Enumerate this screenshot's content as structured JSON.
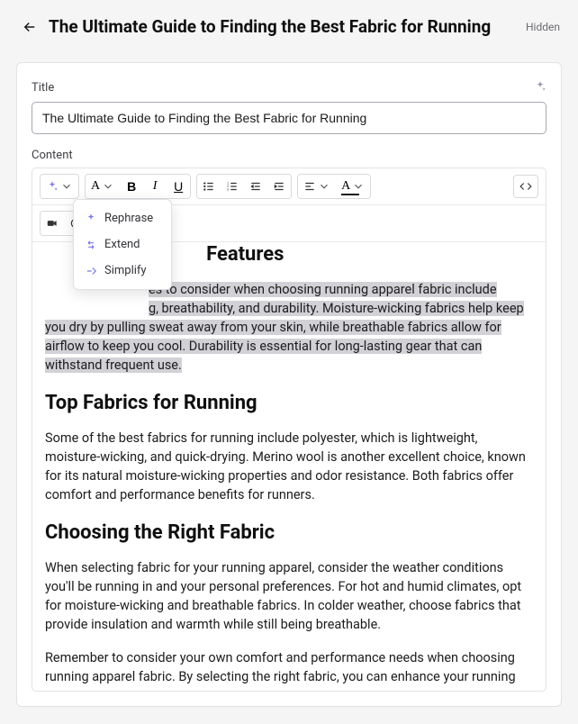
{
  "header": {
    "title": "The Ultimate Guide to Finding the Best Fabric for Running",
    "status": "Hidden"
  },
  "title_field": {
    "label": "Title",
    "value": "The Ultimate Guide to Finding the Best Fabric for Running"
  },
  "content_field": {
    "label": "Content"
  },
  "ai_menu": {
    "rephrase": "Rephrase",
    "extend": "Extend",
    "simplify": "Simplify"
  },
  "editor": {
    "heading_cut": "Features",
    "para1_sel": "es to consider when choosing running apparel fabric include",
    "para1_rest": "g, breathability, and durability. Moisture-wicking fabrics help keep you dry by pulling sweat away from your skin, while breathable fabrics allow for airflow to keep you cool. Durability is essential for long-lasting gear that can withstand frequent use.",
    "h2_top": "Top Fabrics for Running",
    "para2": "Some of the best fabrics for running include polyester, which is lightweight, moisture-wicking, and quick-drying. Merino wool is another excellent choice, known for its natural moisture-wicking properties and odor resistance. Both fabrics offer comfort and performance benefits for runners.",
    "h2_choose": "Choosing the Right Fabric",
    "para3": "When selecting fabric for your running apparel, consider the weather conditions you'll be running in and your personal preferences. For hot and humid climates, opt for moisture-wicking and breathable fabrics. In colder weather, choose fabrics that provide insulation and warmth while still being breathable.",
    "para4": "Remember to consider your own comfort and performance needs when choosing running apparel fabric. By selecting the right fabric, you can enhance your running"
  }
}
